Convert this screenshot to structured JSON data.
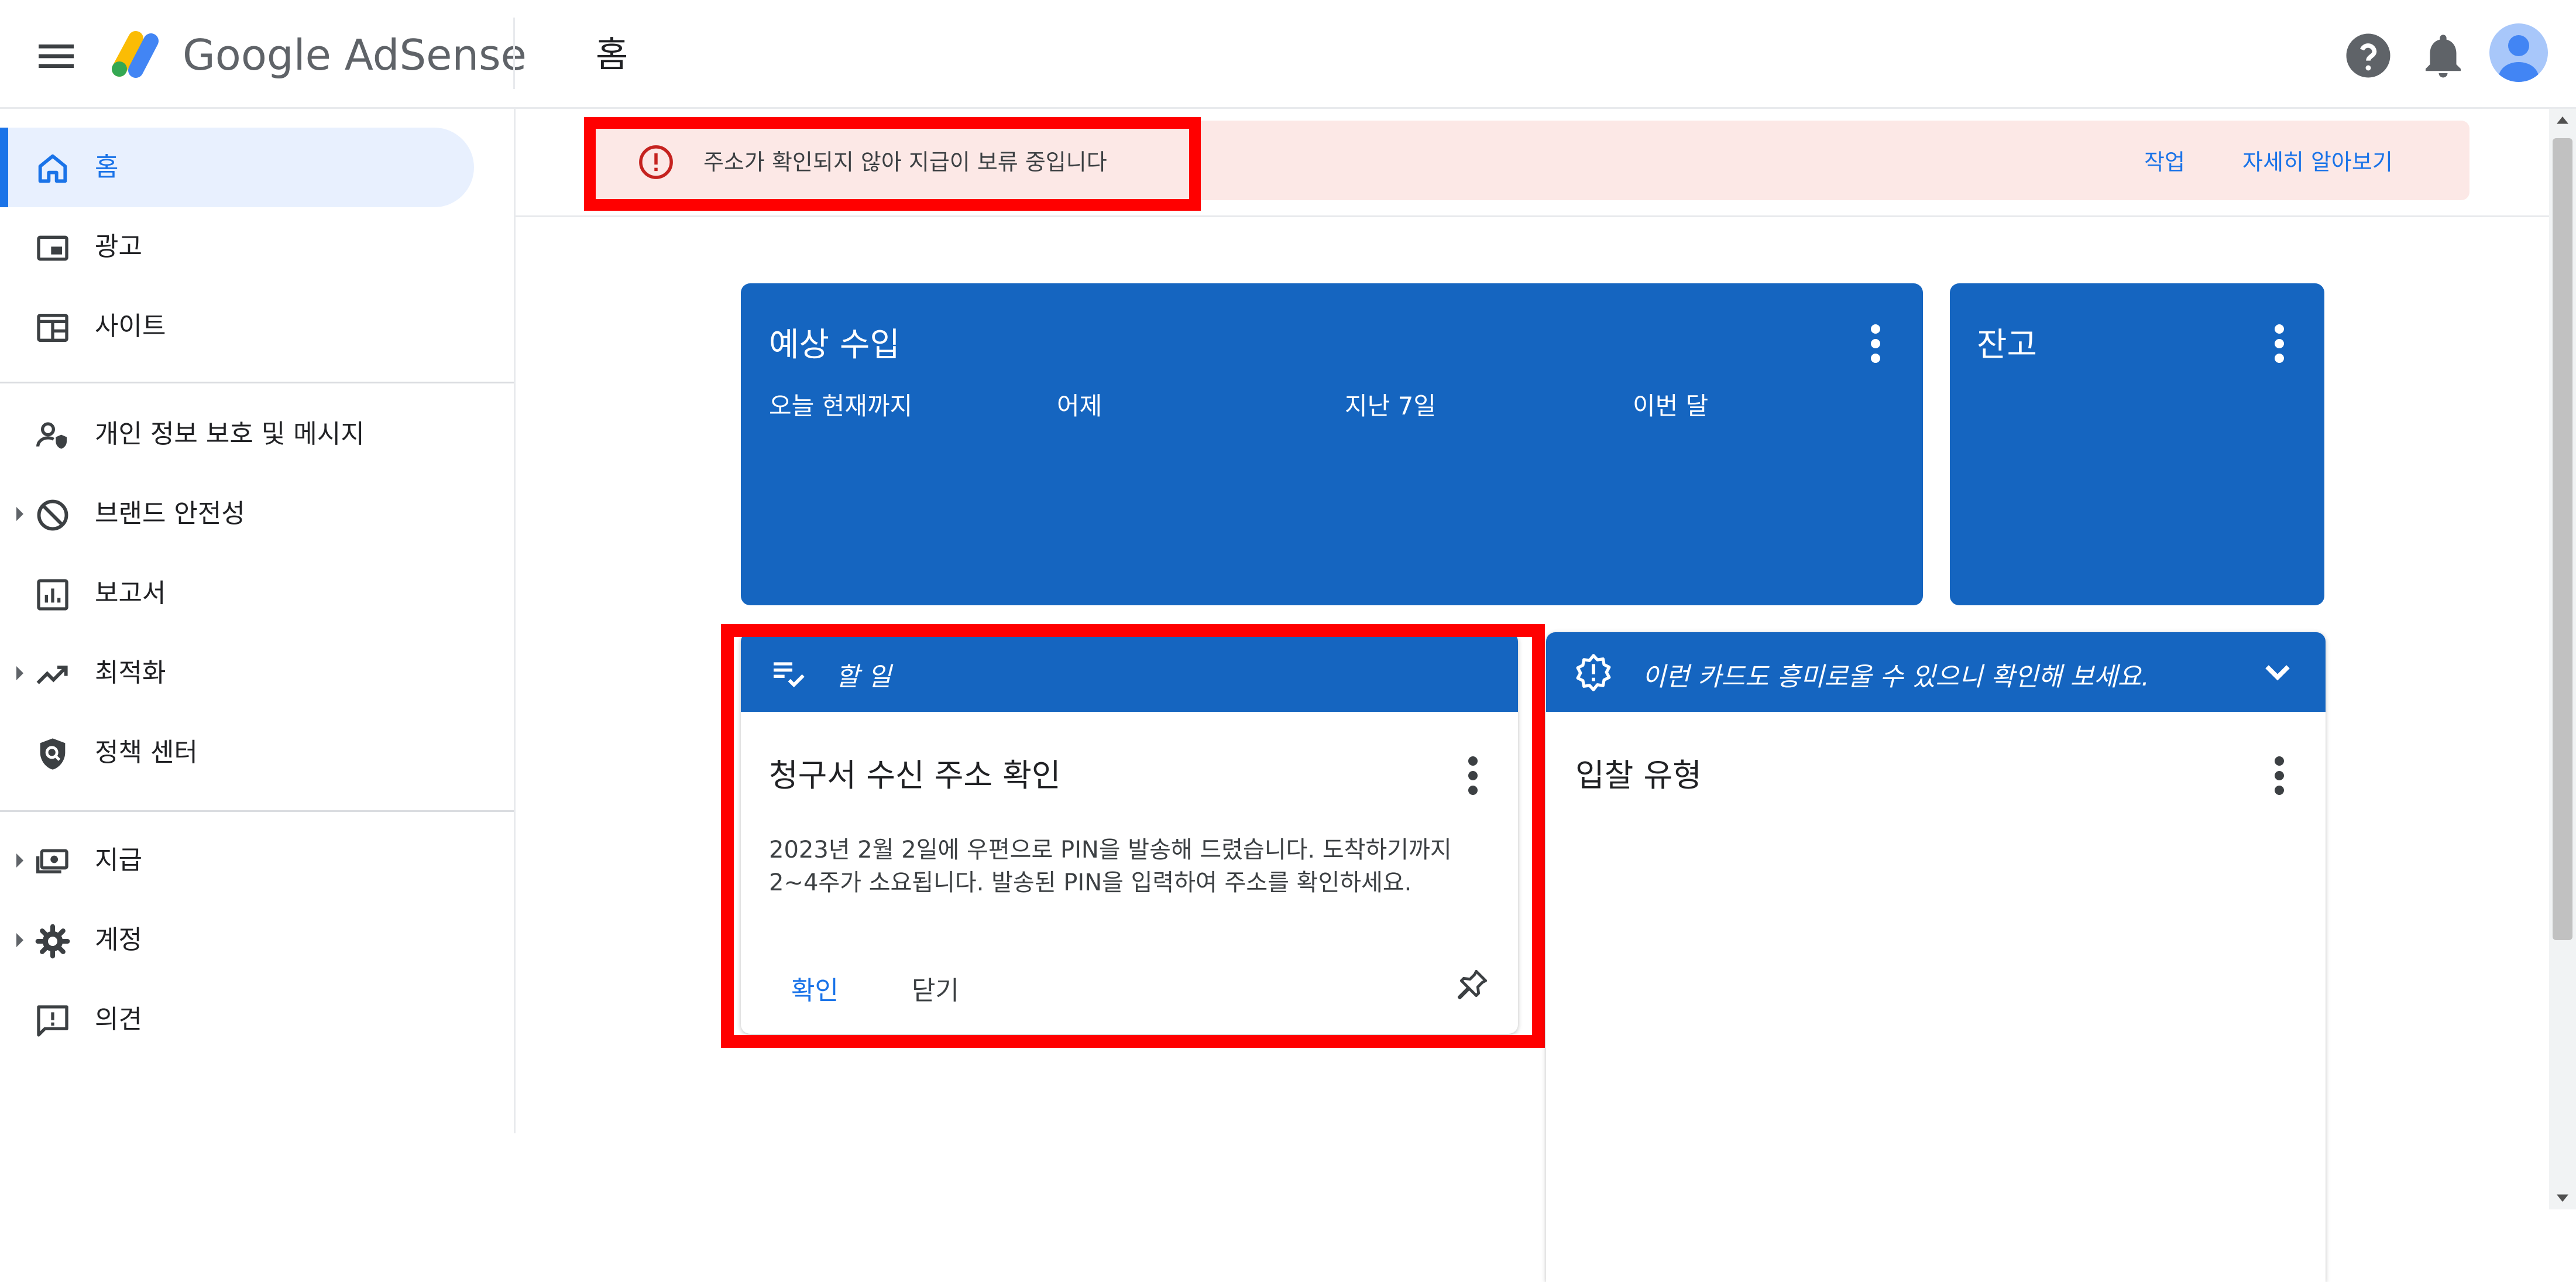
{
  "header": {
    "app_name": "Google AdSense",
    "page_title": "홈"
  },
  "sidebar": {
    "items": [
      {
        "label": "홈",
        "icon": "home-icon",
        "active": true
      },
      {
        "label": "광고",
        "icon": "ads-icon"
      },
      {
        "label": "사이트",
        "icon": "sites-icon"
      },
      {
        "label": "개인 정보 보호 및 메시지",
        "icon": "privacy-person-icon"
      },
      {
        "label": "브랜드 안전성",
        "icon": "block-icon",
        "expandable": true
      },
      {
        "label": "보고서",
        "icon": "reports-icon"
      },
      {
        "label": "최적화",
        "icon": "trending-up-icon",
        "expandable": true
      },
      {
        "label": "정책 센터",
        "icon": "policy-shield-icon"
      },
      {
        "label": "지급",
        "icon": "payments-icon",
        "expandable": true
      },
      {
        "label": "계정",
        "icon": "gear-icon",
        "expandable": true
      },
      {
        "label": "의견",
        "icon": "feedback-icon"
      }
    ]
  },
  "alert": {
    "message": "주소가 확인되지 않아 지급이 보류 중입니다",
    "action_label": "작업",
    "learn_more_label": "자세히 알아보기",
    "color": "#fce8e6"
  },
  "estimated_earnings": {
    "title": "예상 수입",
    "periods": [
      "오늘 현재까지",
      "어제",
      "지난 7일",
      "이번 달"
    ]
  },
  "balance": {
    "title": "잔고"
  },
  "todo": {
    "header": "할 일",
    "title": "청구서 수신 주소 확인",
    "body_line1": "2023년 2월 2일에 우편으로 PIN을 발송해 드렸습니다. 도착하기까지",
    "body_line2": "2~4주가 소요됩니다. 발송된 PIN을 입력하여 주소를 확인하세요.",
    "confirm_label": "확인",
    "close_label": "닫기"
  },
  "suggestion": {
    "header": "이런 카드도 흥미로울 수 있으니 확인해 보세요.",
    "title": "입찰 유형"
  },
  "colors": {
    "card_blue": "#1565c0",
    "link_blue": "#1a73e8",
    "highlight_red": "#ff0000"
  }
}
